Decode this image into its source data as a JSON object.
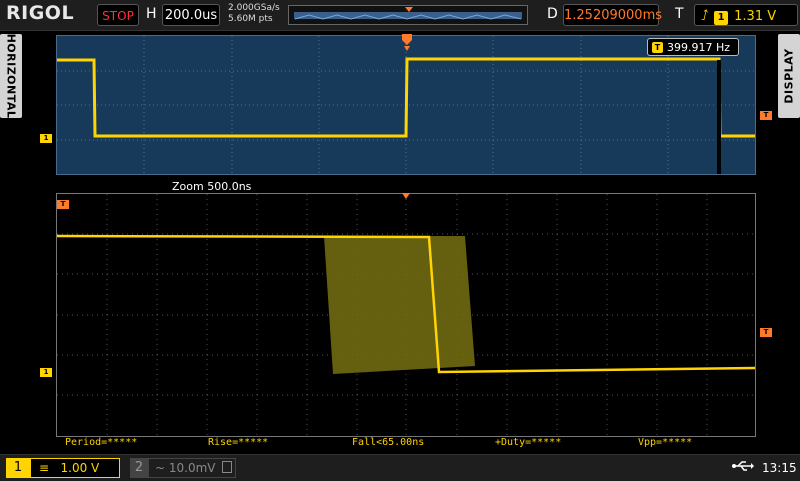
{
  "topbar": {
    "logo": "RIGOL",
    "run_status": "STOP",
    "hscale_label": "H",
    "hscale_value": "200.0us",
    "sample_rate": "2.000GSa/s",
    "memory_depth": "5.60M pts",
    "delay_label": "D",
    "delay_value": "1.25209000ms",
    "trigger_type_label": "T",
    "trigger_source": "1",
    "trigger_level": "1.31 V"
  },
  "sidetabs": {
    "left": "HORIZONTAL",
    "right": "DISPLAY"
  },
  "top_window": {
    "frequency_source": "T",
    "frequency": "399.917 Hz",
    "ch1_marker": "1",
    "trigger_marker": "T"
  },
  "zoom": {
    "label": "Zoom  500.0ns",
    "ch1_marker": "1",
    "trigger_marker": "T"
  },
  "measurements": {
    "period": "Period=*****",
    "rise": "Rise=*****",
    "fall": "Fall<65.00ns",
    "duty": "+Duty=*****",
    "vpp": "Vpp=*****"
  },
  "bottombar": {
    "ch1_number": "1",
    "ch1_coupling": "≡",
    "ch1_scale": "1.00 V",
    "ch2_number": "2",
    "ch2_coupling": "~",
    "ch2_scale": "10.0mV",
    "time": "13:15"
  },
  "colors": {
    "ch1": "#ffd400",
    "trigger": "#ff7a2a",
    "window_bg": "#183a5a",
    "status_stop": "#ff3030"
  },
  "icons": [
    "trigger-position-icon",
    "rising-edge-icon",
    "usb-icon",
    "bandwidth-limit-icon"
  ]
}
